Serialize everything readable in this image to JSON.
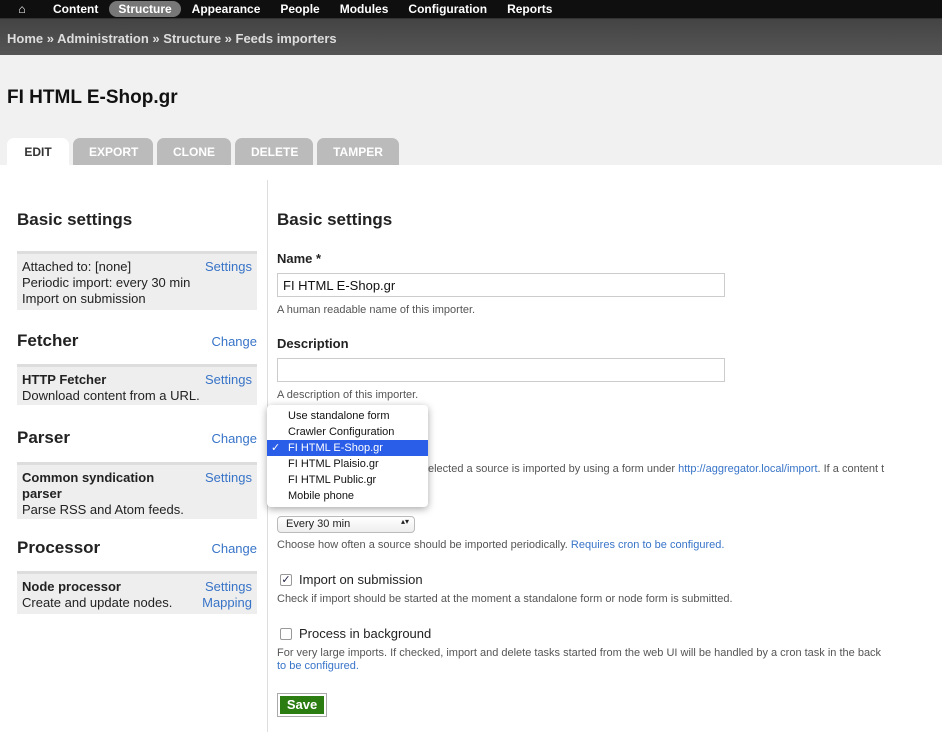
{
  "toolbar": {
    "home_icon": "home-icon",
    "items": [
      "Content",
      "Structure",
      "Appearance",
      "People",
      "Modules",
      "Configuration",
      "Reports"
    ],
    "active": "Structure"
  },
  "breadcrumb": "Home » Administration » Structure » Feeds importers",
  "title": "FI HTML E-Shop.gr",
  "tabs": [
    "EDIT",
    "EXPORT",
    "CLONE",
    "DELETE",
    "TAMPER"
  ],
  "sidebar": {
    "basic": {
      "heading": "Basic settings",
      "lines": [
        "Attached to: [none]",
        "Periodic import: every 30 min",
        "Import on submission"
      ],
      "link": "Settings"
    },
    "fetcher": {
      "heading": "Fetcher",
      "change": "Change",
      "name": "HTTP Fetcher",
      "desc": "Download content from a URL.",
      "link": "Settings"
    },
    "parser": {
      "heading": "Parser",
      "change": "Change",
      "name": "Common syndication parser",
      "desc": "Parse RSS and Atom feeds.",
      "link": "Settings"
    },
    "processor": {
      "heading": "Processor",
      "change": "Change",
      "name": "Node processor",
      "desc": "Create and update nodes.",
      "links": [
        "Settings",
        "Mapping"
      ]
    }
  },
  "form": {
    "heading": "Basic settings",
    "name_label": "Name *",
    "name_value": "FI HTML E-Shop.gr",
    "name_desc": "A human readable name of this importer.",
    "description_label": "Description",
    "description_value": "",
    "description_desc": "A description of this importer.",
    "attach_desc_visible": "elected a source is imported by using a form under",
    "attach_link": "http://aggregator.local/import",
    "attach_desc_tail": ". If a content t",
    "dropdown_options": [
      "Use standalone form",
      "Crawler Configuration",
      "FI HTML E-Shop.gr",
      "FI HTML Plaisio.gr",
      "FI HTML Public.gr",
      "Mobile phone"
    ],
    "dropdown_selected": "FI HTML E-Shop.gr",
    "check_mark": "✓",
    "periodic_value": "Every 30 min",
    "periodic_desc": "Choose how often a source should be imported periodically.",
    "periodic_link": "Requires cron to be configured.",
    "import_on_submission": {
      "label": "Import on submission",
      "checked": true,
      "desc": "Check if import should be started at the moment a standalone form or node form is submitted."
    },
    "process_background": {
      "label": "Process in background",
      "checked": false,
      "desc": "For very large imports. If checked, import and delete tasks started from the web UI will be handled by a cron task in the back",
      "link": "to be configured."
    },
    "save": "Save"
  },
  "colors": {
    "link": "#3874c8",
    "save": "#2b7d12",
    "selected_option": "#2a5ee8"
  }
}
